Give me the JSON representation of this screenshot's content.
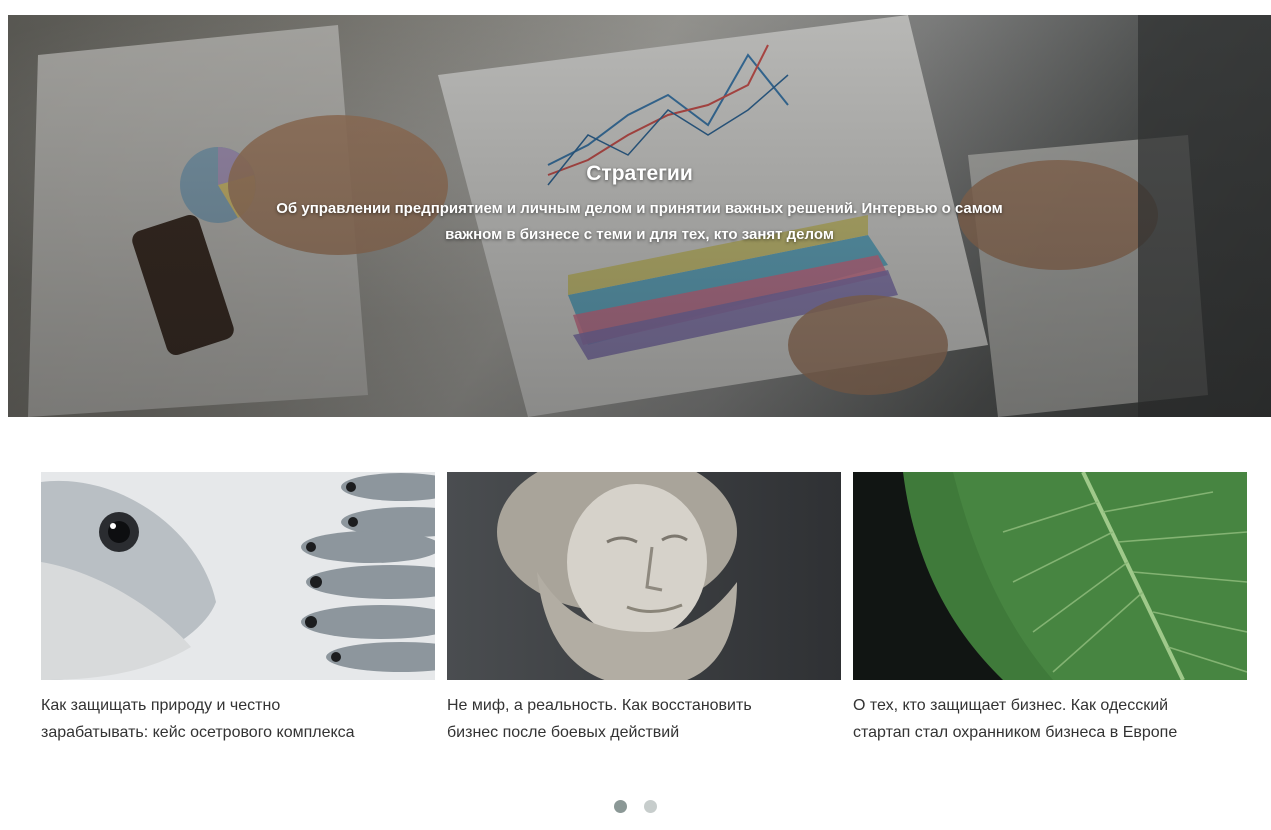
{
  "hero": {
    "title": "Стратегии",
    "description_line1": "Об управлении предприятием и личным делом и принятии важных решений. Интервью о самом",
    "description_line2": "важном в бизнесе с теми и для тех, кто занят делом"
  },
  "cards": [
    {
      "title_line1": "Как защищать природу и честно",
      "title_line2": "зарабатывать: кейс осетрового комплекса",
      "image": "fish-photo"
    },
    {
      "title_line1": "Не миф, а реальность. Как восстановить",
      "title_line2": "бизнес после боевых действий",
      "image": "statue-photo"
    },
    {
      "title_line1": "О тех, кто защищает бизнес. Как одесский",
      "title_line2": "стартап стал охранником бизнеса в Европе",
      "image": "leaf-photo"
    }
  ],
  "pagination": {
    "active_index": 0,
    "total": 2
  },
  "colors": {
    "dot_active": "#8b9896",
    "dot_inactive": "#c7cdcc",
    "card_text": "#333333",
    "hero_text": "#ffffff"
  }
}
